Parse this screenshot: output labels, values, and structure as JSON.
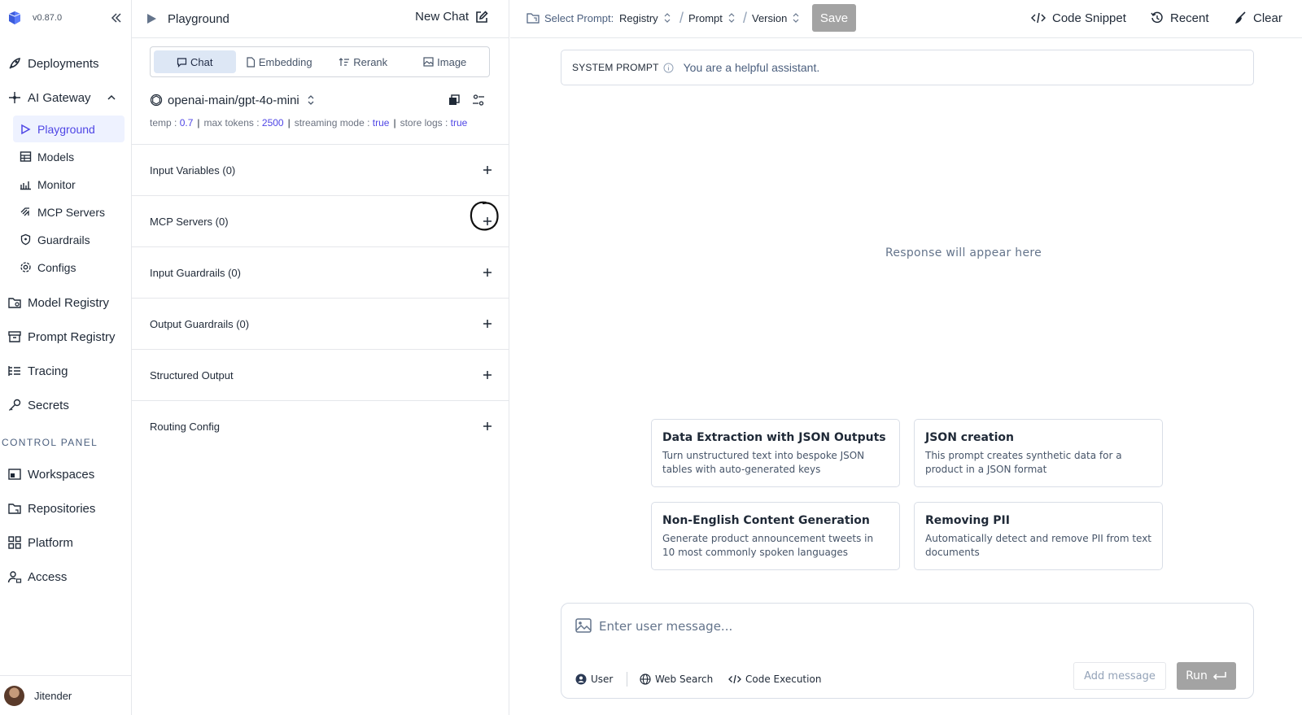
{
  "sidebar": {
    "version": "v0.87.0",
    "nav": [
      {
        "label": "Deployments"
      },
      {
        "label": "AI Gateway"
      }
    ],
    "gateway_items": [
      {
        "label": "Playground"
      },
      {
        "label": "Models"
      },
      {
        "label": "Monitor"
      },
      {
        "label": "MCP Servers"
      },
      {
        "label": "Guardrails"
      },
      {
        "label": "Configs"
      }
    ],
    "nav_after": [
      {
        "label": "Model Registry"
      },
      {
        "label": "Prompt Registry"
      },
      {
        "label": "Tracing"
      },
      {
        "label": "Secrets"
      }
    ],
    "control_panel_label": "CONTROL PANEL",
    "control_items": [
      {
        "label": "Workspaces"
      },
      {
        "label": "Repositories"
      },
      {
        "label": "Platform"
      },
      {
        "label": "Access"
      }
    ],
    "user": {
      "name": "Jitender"
    }
  },
  "config_panel": {
    "title": "Playground",
    "new_chat_label": "New Chat",
    "tabs": [
      {
        "label": "Chat",
        "active": true
      },
      {
        "label": "Embedding"
      },
      {
        "label": "Rerank"
      },
      {
        "label": "Image"
      }
    ],
    "model": "openai-main/gpt-4o-mini",
    "params": {
      "temp_label": "temp :",
      "temp": "0.7",
      "max_tokens_label": "max tokens :",
      "max_tokens": "2500",
      "streaming_label": "streaming mode :",
      "streaming": "true",
      "store_logs_label": "store logs :",
      "store_logs": "true",
      "separator": "|"
    },
    "sections": [
      {
        "label": "Input Variables (0)"
      },
      {
        "label": "MCP Servers (0)"
      },
      {
        "label": "Input Guardrails (0)"
      },
      {
        "label": "Output Guardrails (0)"
      },
      {
        "label": "Structured Output"
      },
      {
        "label": "Routing Config"
      }
    ]
  },
  "topbar": {
    "select_prompt_label": "Select Prompt:",
    "registry_label": "Registry",
    "prompt_label": "Prompt",
    "version_label": "Version",
    "slash": "/",
    "save_label": "Save",
    "code_snippet_label": "Code Snippet",
    "recent_label": "Recent",
    "clear_label": "Clear"
  },
  "main": {
    "system_prompt_label": "SYSTEM PROMPT",
    "system_prompt": "You are a helpful assistant.",
    "response_placeholder": "Response will appear here",
    "cards": [
      {
        "title": "Data Extraction with JSON Outputs",
        "desc": "Turn unstructured text into bespoke JSON tables with auto-generated keys"
      },
      {
        "title": "JSON creation",
        "desc": "This prompt creates synthetic data for a product in a JSON format"
      },
      {
        "title": "Non-English Content Generation",
        "desc": "Generate product announcement tweets in 10 most commonly spoken languages"
      },
      {
        "title": "Removing PII",
        "desc": "Automatically detect and remove PII from text documents"
      }
    ],
    "composer": {
      "placeholder": "Enter user message...",
      "role_label": "User",
      "web_search_label": "Web Search",
      "code_exec_label": "Code Execution",
      "add_message_label": "Add message",
      "run_label": "Run"
    }
  },
  "colors": {
    "accent": "#4f46e5",
    "active_bg": "#eef2ff",
    "disabled_btn": "#a3a3a3"
  }
}
